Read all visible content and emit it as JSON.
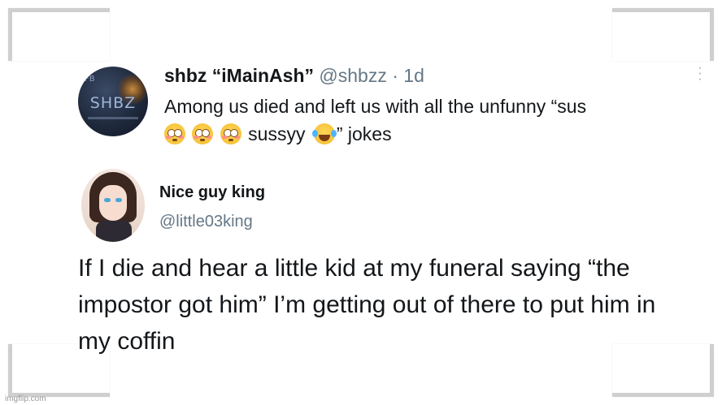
{
  "quoted_tweet": {
    "display_name": "shbz “iMainAsh”",
    "handle": "@shbzz",
    "separator": " · ",
    "time": "1d",
    "avatar_text": "SHBZ",
    "avatar_mark": "FB",
    "body_line1": "Among us died and left us with all the unfunny “sus",
    "body_sussyy": " sussyy ",
    "body_end": "” jokes",
    "emojis": [
      "flushed-face-emoji",
      "flushed-face-emoji",
      "flushed-face-emoji",
      "face-with-tears-of-joy-emoji"
    ]
  },
  "main_tweet": {
    "display_name": "Nice guy king",
    "handle": "@little03king",
    "text": "If I die and hear a little kid at my funeral saying “the impostor got him” I’m getting out of there to put him in my coffin"
  },
  "watermark": "imgflip.com",
  "colors": {
    "text": "#14171a",
    "secondary": "#657786",
    "background": "#ffffff"
  }
}
